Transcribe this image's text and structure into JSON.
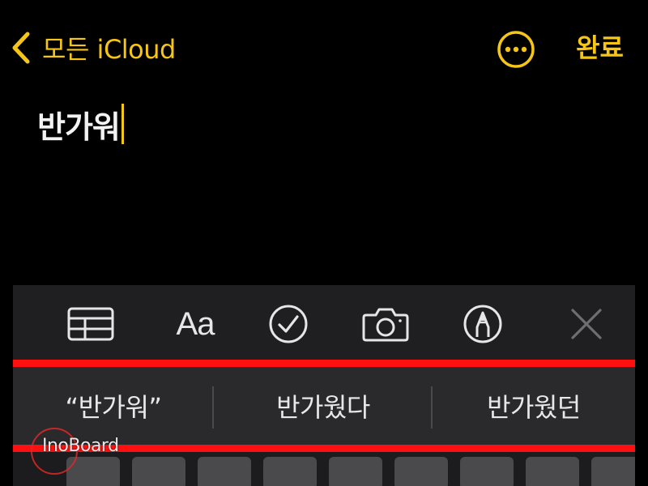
{
  "nav": {
    "back_label": "모든 iCloud",
    "done_label": "완료"
  },
  "note": {
    "text": "반가워"
  },
  "toolbar": {
    "format_label": "Aa",
    "icons": [
      "table-icon",
      "format-icon",
      "checklist-icon",
      "camera-icon",
      "markup-icon",
      "close-icon"
    ]
  },
  "suggestions": [
    {
      "label": "“반가워”"
    },
    {
      "label": "반가웠다"
    },
    {
      "label": "반가웠던"
    }
  ],
  "watermark": {
    "text": "InoBoard"
  },
  "colors": {
    "accent": "#F5C518",
    "background": "#000000",
    "toolbar": "#1F1F21",
    "suggestion_bar": "#2A2A2C",
    "highlight": "#FF1010"
  }
}
